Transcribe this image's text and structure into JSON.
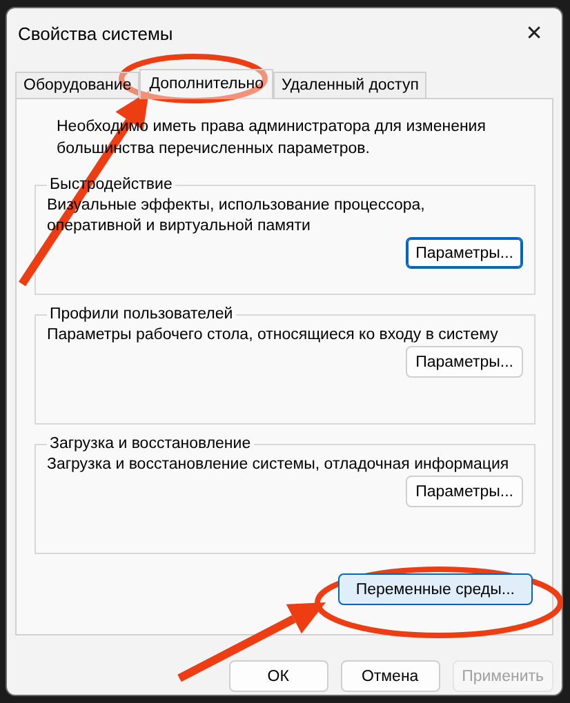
{
  "window": {
    "title": "Свойства системы",
    "close": "✕"
  },
  "tabs": [
    {
      "label": "Оборудование",
      "selected": false
    },
    {
      "label": "Дополнительно",
      "selected": true
    },
    {
      "label": "Удаленный доступ",
      "selected": false
    }
  ],
  "notice": "Необходимо иметь права администратора для изменения большинства перечисленных параметров.",
  "groups": [
    {
      "title": "Быстродействие",
      "description": "Визуальные эффекты, использование процессора, оперативной и виртуальной памяти",
      "button": {
        "label": "Параметры...",
        "focused": true
      }
    },
    {
      "title": "Профили пользователей",
      "description": "Параметры рабочего стола, относящиеся ко входу в систему",
      "button": {
        "label": "Параметры...",
        "focused": false
      }
    },
    {
      "title": "Загрузка и восстановление",
      "description": "Загрузка и восстановление системы, отладочная информация",
      "button": {
        "label": "Параметры...",
        "focused": false
      }
    }
  ],
  "environment_button": {
    "label": "Переменные среды...",
    "highlighted": true
  },
  "buttons": [
    {
      "label": "ОК",
      "disabled": false
    },
    {
      "label": "Отмена",
      "disabled": false
    },
    {
      "label": "Применить",
      "disabled": true
    }
  ]
}
